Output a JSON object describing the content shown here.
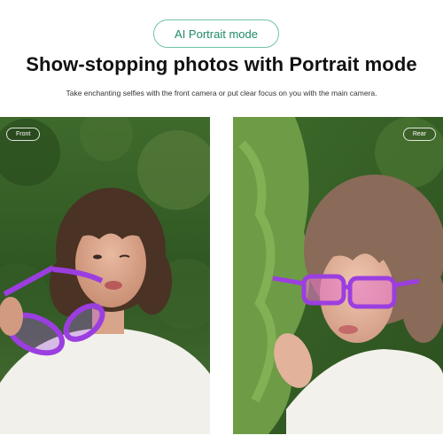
{
  "badge": {
    "label": "AI Portrait mode"
  },
  "heading": {
    "title": "Show-stopping photos with Portrait mode",
    "subtitle": "Take enchanting selfies with the front camera or put clear focus on you with the main camera."
  },
  "photos": [
    {
      "tag": "Front"
    },
    {
      "tag": "Rear"
    }
  ],
  "colors": {
    "accent_border": "#6fc4a3",
    "accent_text": "#1e8a63",
    "glasses": "#9b3ee0"
  }
}
